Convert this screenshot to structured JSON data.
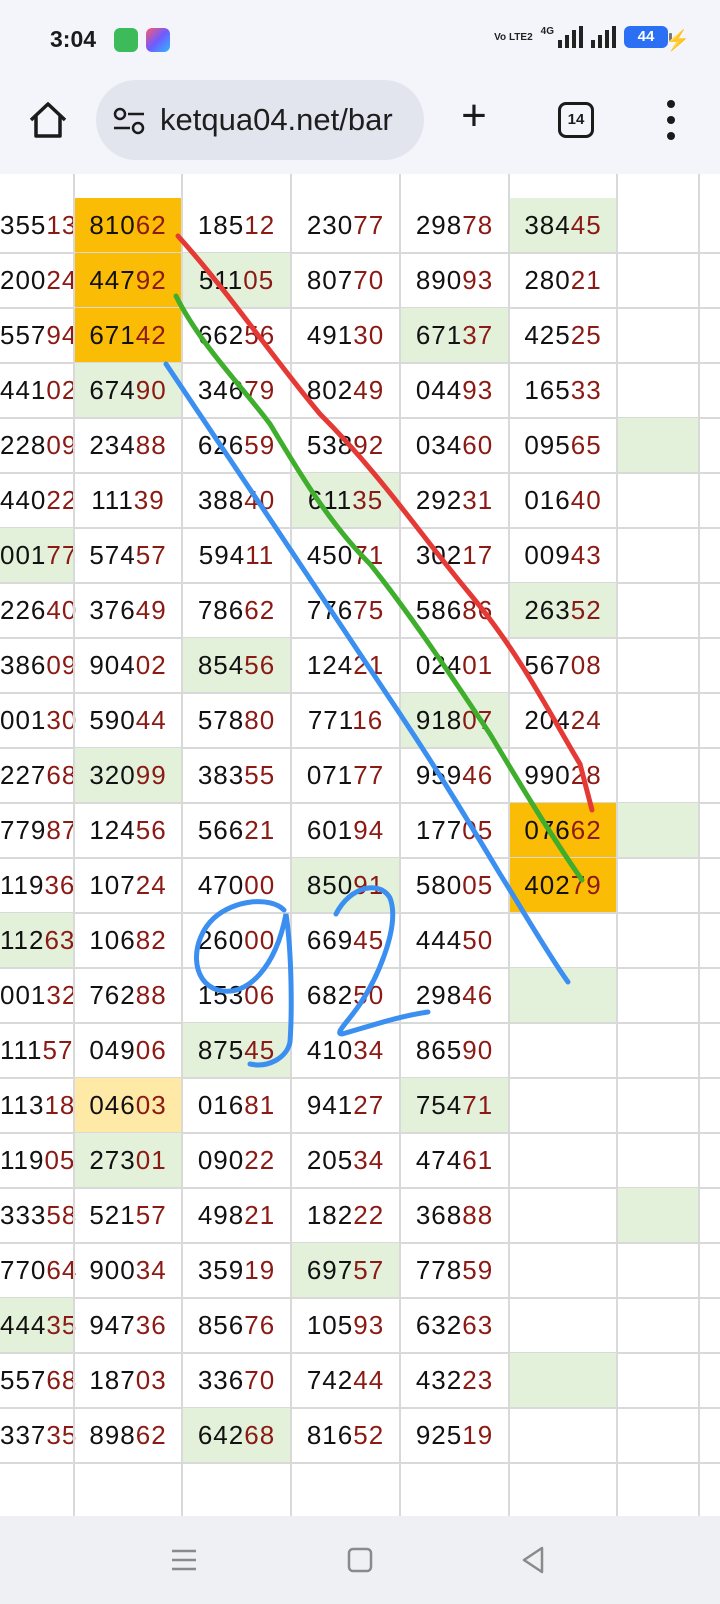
{
  "status_bar": {
    "time": "3:04",
    "network_label": "Vo LTE2",
    "network_type": "4G",
    "battery": "44",
    "icons": [
      "app-green-icon",
      "app-multicolor-icon",
      "signal-icon",
      "battery-icon",
      "charging-icon"
    ]
  },
  "browser": {
    "url": "ketqua04.net/bar",
    "tab_count": "14",
    "icons": [
      "home-icon",
      "site-settings-icon",
      "new-tab-icon",
      "tabs-icon",
      "more-icon"
    ]
  },
  "table": {
    "rows": [
      [
        {
          "t": "35513",
          "bg": ""
        },
        {
          "t": "81062",
          "bg": "orange"
        },
        {
          "t": "18512",
          "bg": ""
        },
        {
          "t": "23077",
          "bg": ""
        },
        {
          "t": "29878",
          "bg": ""
        },
        {
          "t": "38445",
          "bg": "green"
        },
        {
          "t": "",
          "bg": ""
        }
      ],
      [
        {
          "t": "20024",
          "bg": ""
        },
        {
          "t": "44792",
          "bg": "orange"
        },
        {
          "t": "51105",
          "bg": "green"
        },
        {
          "t": "80770",
          "bg": ""
        },
        {
          "t": "89093",
          "bg": ""
        },
        {
          "t": "28021",
          "bg": ""
        },
        {
          "t": "",
          "bg": ""
        }
      ],
      [
        {
          "t": "55794",
          "bg": ""
        },
        {
          "t": "67142",
          "bg": "orange"
        },
        {
          "t": "66256",
          "bg": ""
        },
        {
          "t": "49130",
          "bg": ""
        },
        {
          "t": "67137",
          "bg": "green"
        },
        {
          "t": "42525",
          "bg": ""
        },
        {
          "t": "",
          "bg": ""
        }
      ],
      [
        {
          "t": "44102",
          "bg": ""
        },
        {
          "t": "67490",
          "bg": "green"
        },
        {
          "t": "34679",
          "bg": ""
        },
        {
          "t": "80249",
          "bg": ""
        },
        {
          "t": "04493",
          "bg": ""
        },
        {
          "t": "16533",
          "bg": ""
        },
        {
          "t": "",
          "bg": ""
        }
      ],
      [
        {
          "t": "22809",
          "bg": ""
        },
        {
          "t": "23488",
          "bg": ""
        },
        {
          "t": "62659",
          "bg": ""
        },
        {
          "t": "53892",
          "bg": ""
        },
        {
          "t": "03460",
          "bg": ""
        },
        {
          "t": "09565",
          "bg": ""
        },
        {
          "t": "",
          "bg": "green"
        }
      ],
      [
        {
          "t": "44022",
          "bg": ""
        },
        {
          "t": "11139",
          "bg": ""
        },
        {
          "t": "38840",
          "bg": ""
        },
        {
          "t": "61135",
          "bg": "green"
        },
        {
          "t": "29231",
          "bg": ""
        },
        {
          "t": "01640",
          "bg": ""
        },
        {
          "t": "",
          "bg": ""
        }
      ],
      [
        {
          "t": "00177",
          "bg": "green"
        },
        {
          "t": "57457",
          "bg": ""
        },
        {
          "t": "59411",
          "bg": ""
        },
        {
          "t": "45071",
          "bg": ""
        },
        {
          "t": "30217",
          "bg": ""
        },
        {
          "t": "00943",
          "bg": ""
        },
        {
          "t": "",
          "bg": ""
        }
      ],
      [
        {
          "t": "22640",
          "bg": ""
        },
        {
          "t": "37649",
          "bg": ""
        },
        {
          "t": "78662",
          "bg": ""
        },
        {
          "t": "77675",
          "bg": ""
        },
        {
          "t": "58686",
          "bg": ""
        },
        {
          "t": "26352",
          "bg": "green"
        },
        {
          "t": "",
          "bg": ""
        }
      ],
      [
        {
          "t": "38609",
          "bg": ""
        },
        {
          "t": "90402",
          "bg": ""
        },
        {
          "t": "85456",
          "bg": "green"
        },
        {
          "t": "12421",
          "bg": ""
        },
        {
          "t": "02401",
          "bg": ""
        },
        {
          "t": "56708",
          "bg": ""
        },
        {
          "t": "",
          "bg": ""
        }
      ],
      [
        {
          "t": "00130",
          "bg": ""
        },
        {
          "t": "59044",
          "bg": ""
        },
        {
          "t": "57880",
          "bg": ""
        },
        {
          "t": "77116",
          "bg": ""
        },
        {
          "t": "91807",
          "bg": "green"
        },
        {
          "t": "20424",
          "bg": ""
        },
        {
          "t": "",
          "bg": ""
        }
      ],
      [
        {
          "t": "22768",
          "bg": ""
        },
        {
          "t": "32099",
          "bg": "green"
        },
        {
          "t": "38355",
          "bg": ""
        },
        {
          "t": "07177",
          "bg": ""
        },
        {
          "t": "95946",
          "bg": ""
        },
        {
          "t": "99028",
          "bg": ""
        },
        {
          "t": "",
          "bg": ""
        }
      ],
      [
        {
          "t": "77987",
          "bg": ""
        },
        {
          "t": "12456",
          "bg": ""
        },
        {
          "t": "56621",
          "bg": ""
        },
        {
          "t": "60194",
          "bg": ""
        },
        {
          "t": "17705",
          "bg": ""
        },
        {
          "t": "07662",
          "bg": "orange"
        },
        {
          "t": "",
          "bg": "green"
        }
      ],
      [
        {
          "t": "11936",
          "bg": ""
        },
        {
          "t": "10724",
          "bg": ""
        },
        {
          "t": "47000",
          "bg": ""
        },
        {
          "t": "85091",
          "bg": "green"
        },
        {
          "t": "58005",
          "bg": ""
        },
        {
          "t": "40279",
          "bg": "orange"
        },
        {
          "t": "",
          "bg": ""
        }
      ],
      [
        {
          "t": "11263",
          "bg": "green"
        },
        {
          "t": "10682",
          "bg": ""
        },
        {
          "t": "26000",
          "bg": ""
        },
        {
          "t": "66945",
          "bg": ""
        },
        {
          "t": "44450",
          "bg": ""
        },
        {
          "t": "",
          "bg": ""
        },
        {
          "t": "",
          "bg": ""
        }
      ],
      [
        {
          "t": "00132",
          "bg": ""
        },
        {
          "t": "76288",
          "bg": ""
        },
        {
          "t": "15306",
          "bg": ""
        },
        {
          "t": "68250",
          "bg": ""
        },
        {
          "t": "29846",
          "bg": ""
        },
        {
          "t": "",
          "bg": "green"
        },
        {
          "t": "",
          "bg": ""
        }
      ],
      [
        {
          "t": "11157",
          "bg": ""
        },
        {
          "t": "04906",
          "bg": ""
        },
        {
          "t": "87545",
          "bg": "green"
        },
        {
          "t": "41034",
          "bg": ""
        },
        {
          "t": "86590",
          "bg": ""
        },
        {
          "t": "",
          "bg": ""
        },
        {
          "t": "",
          "bg": ""
        }
      ],
      [
        {
          "t": "11318",
          "bg": ""
        },
        {
          "t": "04603",
          "bg": "lightyellow"
        },
        {
          "t": "01681",
          "bg": ""
        },
        {
          "t": "94127",
          "bg": ""
        },
        {
          "t": "75471",
          "bg": "green"
        },
        {
          "t": "",
          "bg": ""
        },
        {
          "t": "",
          "bg": ""
        }
      ],
      [
        {
          "t": "11905",
          "bg": ""
        },
        {
          "t": "27301",
          "bg": "green"
        },
        {
          "t": "09022",
          "bg": ""
        },
        {
          "t": "20534",
          "bg": ""
        },
        {
          "t": "47461",
          "bg": ""
        },
        {
          "t": "",
          "bg": ""
        },
        {
          "t": "",
          "bg": ""
        }
      ],
      [
        {
          "t": "33358",
          "bg": ""
        },
        {
          "t": "52157",
          "bg": ""
        },
        {
          "t": "49821",
          "bg": ""
        },
        {
          "t": "18222",
          "bg": ""
        },
        {
          "t": "36888",
          "bg": ""
        },
        {
          "t": "",
          "bg": ""
        },
        {
          "t": "",
          "bg": "green"
        }
      ],
      [
        {
          "t": "77064",
          "bg": ""
        },
        {
          "t": "90034",
          "bg": ""
        },
        {
          "t": "35919",
          "bg": ""
        },
        {
          "t": "69757",
          "bg": "green"
        },
        {
          "t": "77859",
          "bg": ""
        },
        {
          "t": "",
          "bg": ""
        },
        {
          "t": "",
          "bg": ""
        }
      ],
      [
        {
          "t": "44435",
          "bg": "green"
        },
        {
          "t": "94736",
          "bg": ""
        },
        {
          "t": "85676",
          "bg": ""
        },
        {
          "t": "10593",
          "bg": ""
        },
        {
          "t": "63263",
          "bg": ""
        },
        {
          "t": "",
          "bg": ""
        },
        {
          "t": "",
          "bg": ""
        }
      ],
      [
        {
          "t": "55768",
          "bg": ""
        },
        {
          "t": "18703",
          "bg": ""
        },
        {
          "t": "33670",
          "bg": ""
        },
        {
          "t": "74244",
          "bg": ""
        },
        {
          "t": "43223",
          "bg": ""
        },
        {
          "t": "",
          "bg": "green"
        },
        {
          "t": "",
          "bg": ""
        }
      ],
      [
        {
          "t": "33735",
          "bg": ""
        },
        {
          "t": "89862",
          "bg": ""
        },
        {
          "t": "64268",
          "bg": "green"
        },
        {
          "t": "81652",
          "bg": ""
        },
        {
          "t": "92519",
          "bg": ""
        },
        {
          "t": "",
          "bg": ""
        },
        {
          "t": "",
          "bg": ""
        }
      ]
    ]
  },
  "annotations": {
    "handwritten_text": "92",
    "line_colors": {
      "red": "#e53935",
      "green": "#3fae2c",
      "blue": "#3b8ff0"
    }
  },
  "colors": {
    "green_cell": "#e3f1da",
    "orange_cell": "#fbbc05",
    "light_yellow_cell": "#ffe9a6",
    "last_digits": "#8b1a14"
  },
  "nav_bar": {
    "icons": [
      "menu-icon",
      "home-square-icon",
      "back-icon"
    ]
  }
}
